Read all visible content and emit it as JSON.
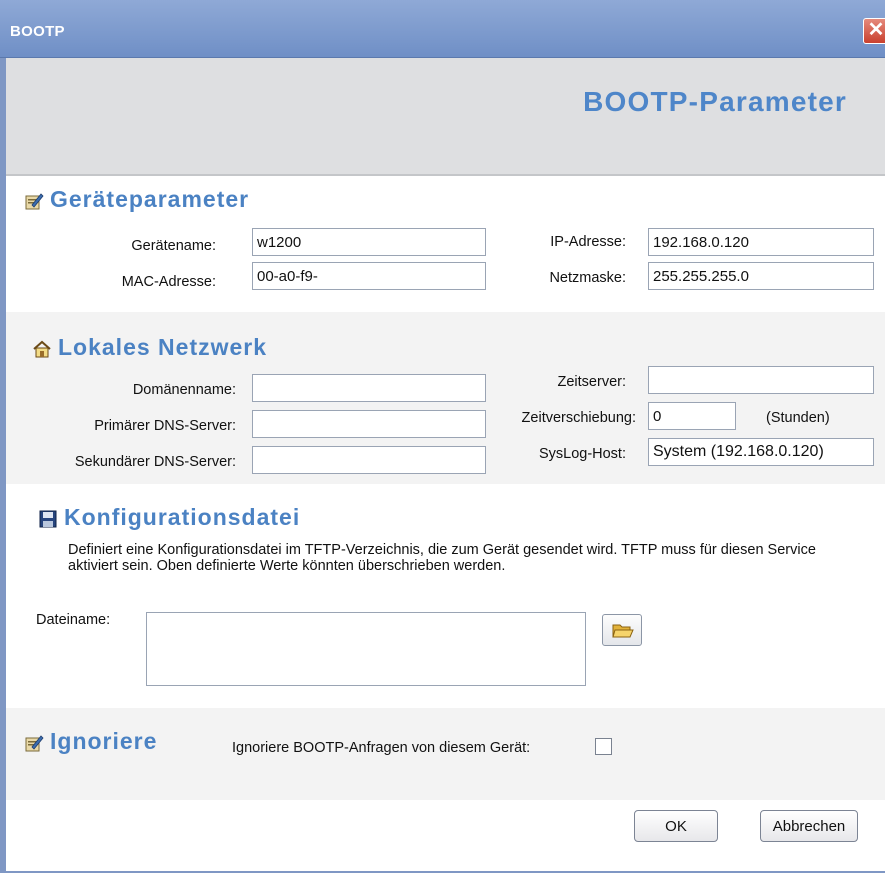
{
  "window": {
    "title": "BOOTP",
    "close_glyph": "✕"
  },
  "header": {
    "title": "BOOTP-Parameter"
  },
  "device_params": {
    "title": "Geräteparameter",
    "icon": "edit-icon",
    "device_name_label": "Gerätename:",
    "device_name_value": "w1200",
    "mac_label": "MAC-Adresse:",
    "mac_value": "00-a0-f9-",
    "ip_label": "IP-Adresse:",
    "ip_value": "192.168.0.120",
    "netmask_label": "Netzmaske:",
    "netmask_value": "255.255.255.0"
  },
  "local_network": {
    "title": "Lokales Netzwerk",
    "icon": "home-icon",
    "domain_label": "Domänenname:",
    "domain_value": "",
    "primary_dns_label": "Primärer DNS-Server:",
    "primary_dns_value": "",
    "secondary_dns_label": "Sekundärer DNS-Server:",
    "secondary_dns_value": "",
    "timeserver_label": "Zeitserver:",
    "timeserver_value": "",
    "timeshift_label": "Zeitverschiebung:",
    "timeshift_value": "0",
    "timeshift_unit": "(Stunden)",
    "syslog_label": "SysLog-Host:",
    "syslog_value": "System (192.168.0.120)"
  },
  "config_file": {
    "title": "Konfigurationsdatei",
    "icon": "save-icon",
    "description": "Definiert eine Konfigurationsdatei im TFTP-Verzeichnis, die zum Gerät gesendet wird. TFTP muss für diesen Service aktiviert sein. Oben definierte Werte könnten überschrieben werden.",
    "filename_label": "Dateiname:",
    "filename_value": "",
    "browse_icon": "folder-open-icon"
  },
  "ignore": {
    "title": "Ignoriere",
    "icon": "edit-icon",
    "checkbox_label": "Ignoriere BOOTP-Anfragen von diesem Gerät:",
    "checked": false
  },
  "buttons": {
    "ok": "OK",
    "cancel": "Abbrechen"
  }
}
